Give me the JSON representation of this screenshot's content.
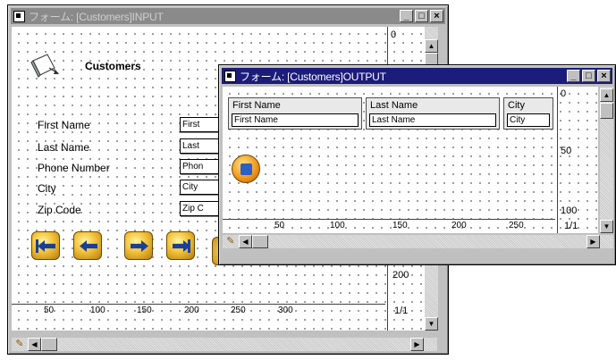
{
  "input_window": {
    "title": "フォーム: [Customers]INPUT",
    "header_label": "Customers",
    "fields": [
      {
        "label": "First Name",
        "placeholder": "First"
      },
      {
        "label": "Last Name",
        "placeholder": "Last"
      },
      {
        "label": "Phone Number",
        "placeholder": "Phon"
      },
      {
        "label": "City",
        "placeholder": "City"
      },
      {
        "label": "Zip Code",
        "placeholder": "Zip C"
      }
    ],
    "ruler": [
      "50",
      "100",
      "150",
      "200",
      "250",
      "300"
    ],
    "vruler": [
      "0",
      "200"
    ],
    "page_indicator": "1/1"
  },
  "output_window": {
    "title": "フォーム: [Customers]OUTPUT",
    "columns": [
      {
        "header": "First Name",
        "field": "First Name"
      },
      {
        "header": "Last Name",
        "field": "Last Name"
      },
      {
        "header": "City",
        "field": "City"
      }
    ],
    "ruler": [
      "50",
      "100",
      "150",
      "200",
      "250"
    ],
    "vruler": [
      "0",
      "50",
      "100"
    ],
    "page_indicator": "1/1"
  },
  "title_buttons": {
    "minimize": "_",
    "maximize": "□",
    "close": "×"
  },
  "icons": {
    "form": "form-icon",
    "nav": [
      "first-record-icon",
      "previous-record-icon",
      "next-record-icon",
      "last-record-icon",
      "add-record-icon",
      "delete-record-icon",
      "accept-icon"
    ]
  }
}
